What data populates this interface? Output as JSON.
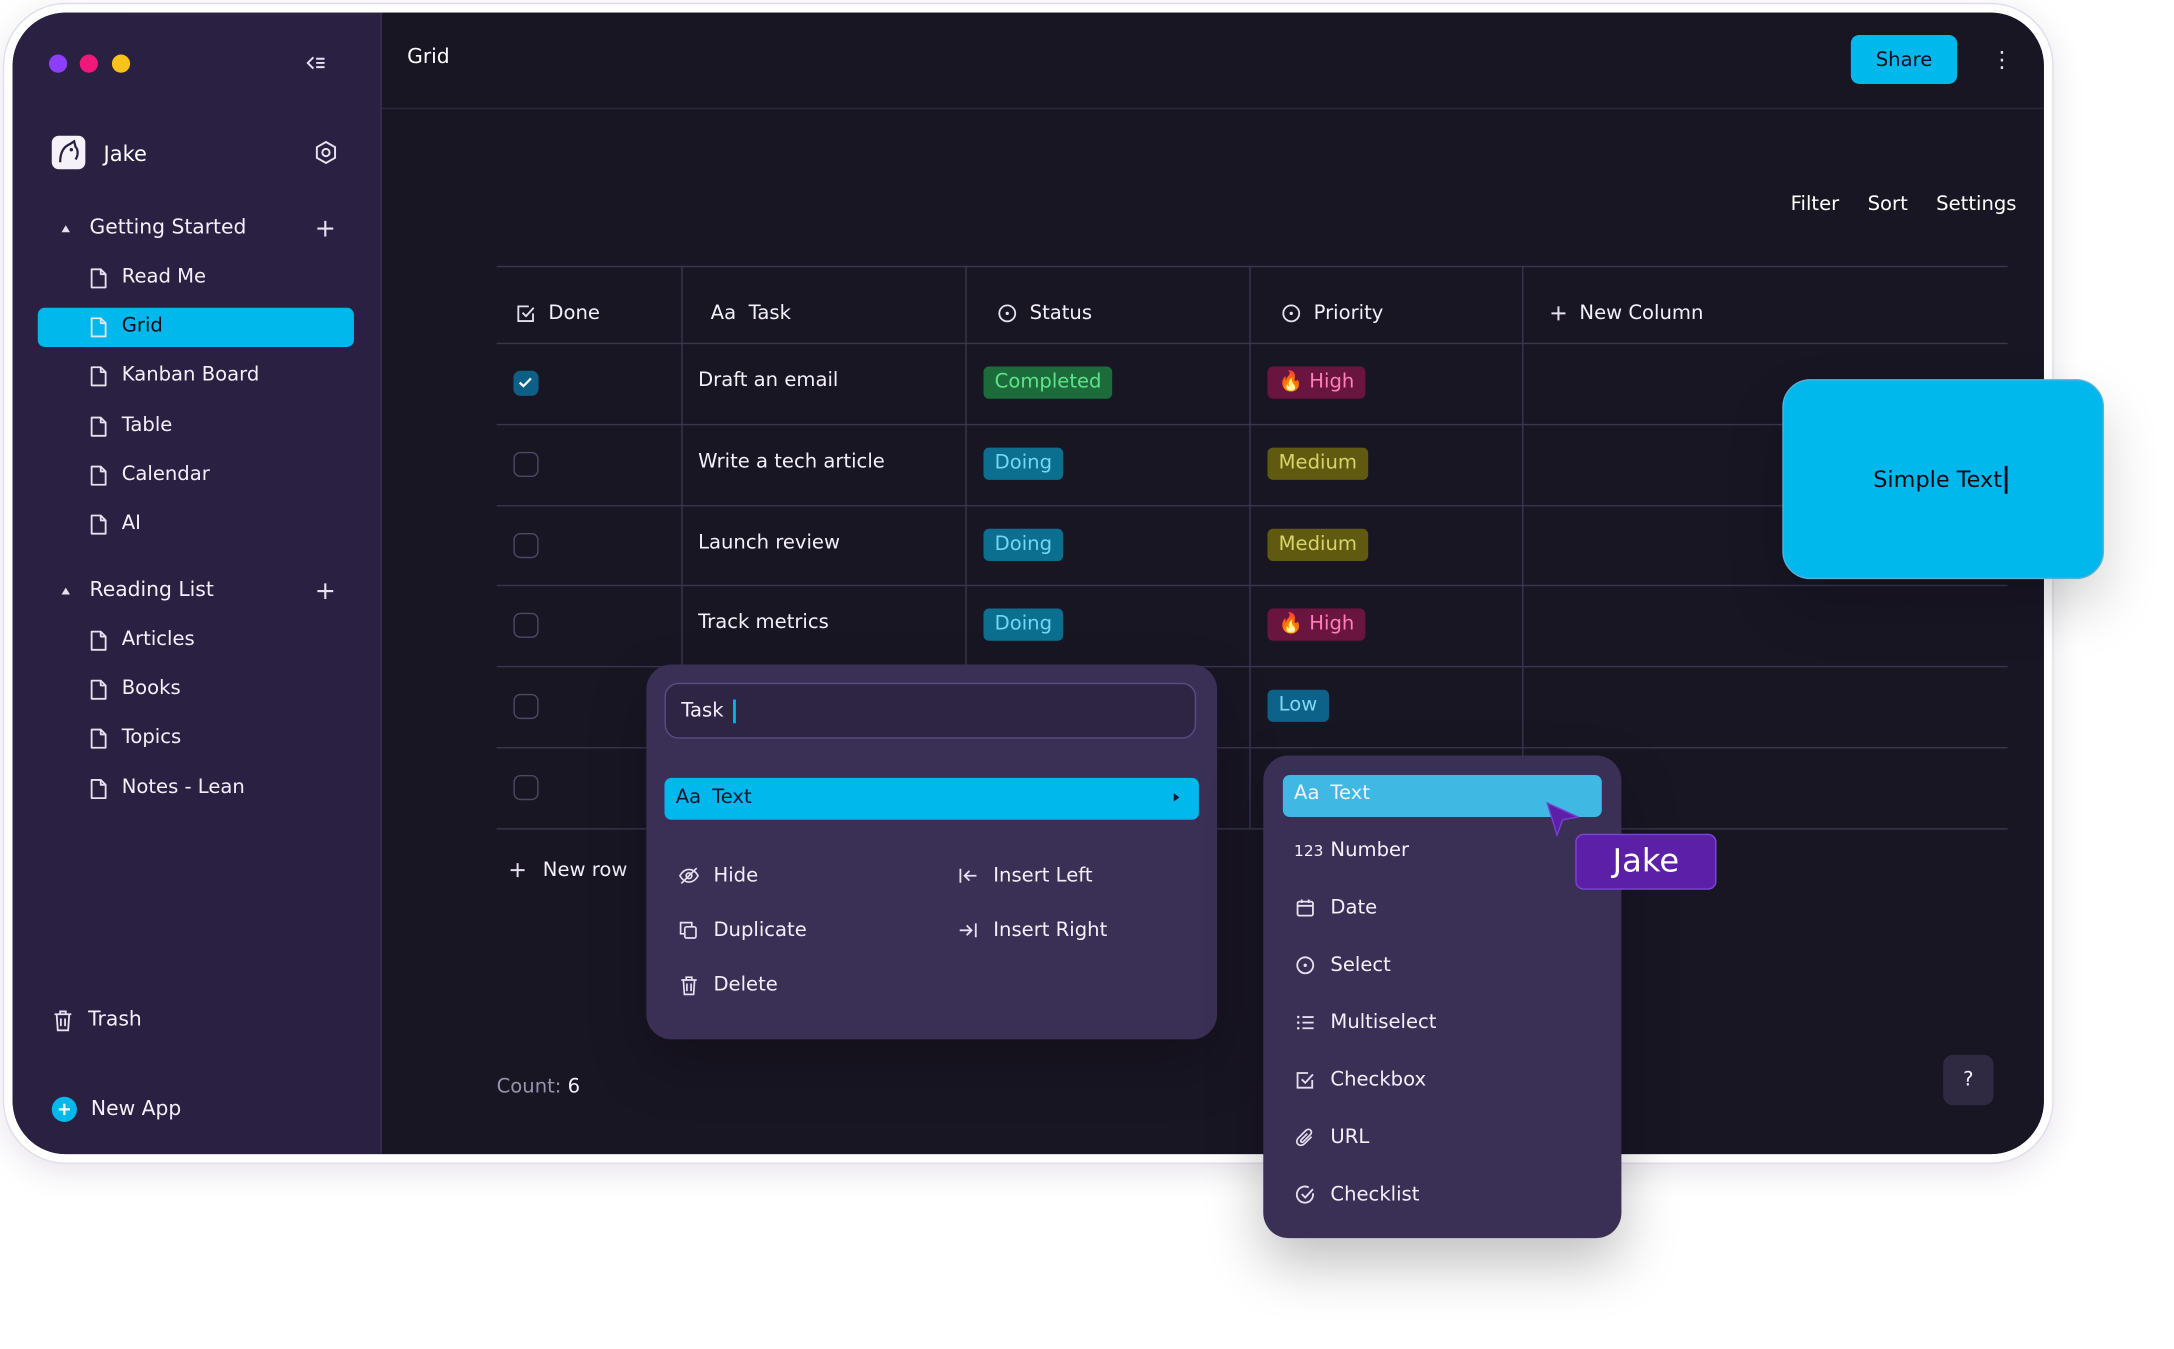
{
  "window": {
    "dot_colors": [
      "#8b3ffc",
      "#f0197a",
      "#f7c21a"
    ]
  },
  "sidebar": {
    "user_name": "Jake",
    "sections": [
      {
        "label": "Getting Started",
        "items": [
          "Read Me",
          "Grid",
          "Kanban Board",
          "Table",
          "Calendar",
          "AI"
        ]
      },
      {
        "label": "Reading List",
        "items": [
          "Articles",
          "Books",
          "Topics",
          "Notes - Lean"
        ]
      }
    ],
    "active_item": "Grid",
    "trash_label": "Trash",
    "new_app_label": "New App"
  },
  "header": {
    "title": "Grid",
    "share_label": "Share",
    "more_label": "⋮"
  },
  "toolbar": {
    "filter": "Filter",
    "sort": "Sort",
    "settings": "Settings"
  },
  "table": {
    "columns": [
      {
        "label": "Done",
        "icon": "checkbox-icon"
      },
      {
        "label": "Task",
        "icon": "text-aa-icon",
        "prefix": "Aa"
      },
      {
        "label": "Status",
        "icon": "select-icon"
      },
      {
        "label": "Priority",
        "icon": "select-icon"
      },
      {
        "label": "New Column",
        "icon": "plus-icon"
      }
    ],
    "rows": [
      {
        "done": true,
        "task": "Draft an email",
        "status": "Completed",
        "priority": "🔥 High"
      },
      {
        "done": false,
        "task": "Write a tech article",
        "status": "Doing",
        "priority": "Medium"
      },
      {
        "done": false,
        "task": "Launch review",
        "status": "Doing",
        "priority": "Medium"
      },
      {
        "done": false,
        "task": "Track metrics",
        "status": "Doing",
        "priority": "🔥 High"
      },
      {
        "done": false,
        "task": "",
        "status": "",
        "priority": "Low"
      },
      {
        "done": false,
        "task": "",
        "status": "",
        "priority": ""
      }
    ],
    "new_row_label": "New row",
    "count_label": "Count:",
    "count_value": "6"
  },
  "colors": {
    "accent": "#00b8ec",
    "status_completed_bg": "#1c6b3a",
    "status_completed_fg": "#5ee38b",
    "status_doing_bg": "#0d6f8f",
    "status_doing_fg": "#6fd8f6",
    "priority_high_bg": "#6a1440",
    "priority_high_fg": "#ff7fb6",
    "priority_medium_bg": "#5f5a10",
    "priority_medium_fg": "#d9d469",
    "priority_low_bg": "#0c6289",
    "priority_low_fg": "#7fd9f5",
    "cursor_badge": "#5b1fa8"
  },
  "column_menu": {
    "input_value": "Task",
    "type_label": "Text",
    "type_prefix": "Aa",
    "actions": [
      {
        "label": "Hide",
        "icon": "eye-off-icon"
      },
      {
        "label": "Insert Left",
        "icon": "arrow-left-bar-icon"
      },
      {
        "label": "Duplicate",
        "icon": "copy-icon"
      },
      {
        "label": "Insert Right",
        "icon": "arrow-right-bar-icon"
      },
      {
        "label": "Delete",
        "icon": "trash-icon"
      }
    ]
  },
  "type_menu": {
    "items": [
      {
        "label": "Text",
        "icon": "text-aa-icon",
        "prefix": "Aa"
      },
      {
        "label": "Number",
        "icon": "number-icon",
        "prefix": "123"
      },
      {
        "label": "Date",
        "icon": "calendar-icon"
      },
      {
        "label": "Select",
        "icon": "select-icon"
      },
      {
        "label": "Multiselect",
        "icon": "list-icon"
      },
      {
        "label": "Checkbox",
        "icon": "checkbox-icon"
      },
      {
        "label": "URL",
        "icon": "paperclip-icon"
      },
      {
        "label": "Checklist",
        "icon": "check-circle-icon"
      }
    ]
  },
  "cursor_badge_label": "Jake",
  "floating_card_text": "Simple Text",
  "help_label": "?"
}
